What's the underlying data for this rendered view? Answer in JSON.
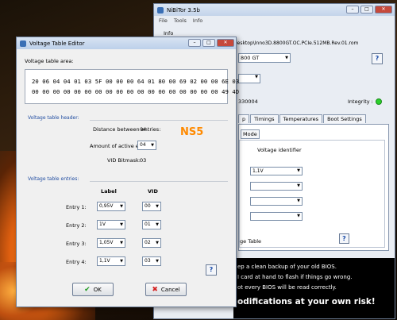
{
  "back_window": {
    "title": "NiBiTor 3.5b",
    "menu": [
      "File",
      "Tools",
      "Info"
    ],
    "info_label": "Info",
    "bios_path": "\\Desktop\\Inno3D.8800GT.OC.PCIe.512MB.Rev.01.rom",
    "card_select": "800 GT",
    "code_text": "330004",
    "integrity_label": "Integrity :",
    "integrity_color": "#2bd02b",
    "tabs": [
      "p",
      "Timings",
      "Temperatures",
      "Boot Settings"
    ],
    "mode_label": "Mode",
    "voltage_identifier_label": "Voltage identifier",
    "voltage_selects": [
      "1,1V",
      "",
      "",
      "",
      ""
    ],
    "voltage_table_label": "ge Table",
    "warnings": [
      "ep a clean backup of your old BIOS.",
      "I card at hand to flash if things go wrong.",
      "ot every BIOS will be read correctly."
    ],
    "warning_big": "odifications at your own risk!"
  },
  "editor": {
    "title": "Voltage Table Editor",
    "area_label": "Voltage table area:",
    "hex_lines": [
      "20 06 04 04 01 03 5F 00 00 00 64 01 80 00 69 02 00 00 6E 03",
      "00 00 00 00 00 00 00 00 00 00 00 00 00 00 00 00 00 00 49 4D"
    ],
    "header_section": "Voltage table header:",
    "distance_label": "Distance between entries:",
    "distance_value": "04",
    "active_label": "Amount of active entries:",
    "active_value": "04",
    "bitmask_label": "VID Bitmask:",
    "bitmask_value": "03",
    "annotation": "NS5",
    "entries_section": "Voltage table entries:",
    "col_label": "Label",
    "col_vid": "VID",
    "entries": [
      {
        "name": "Entry 1:",
        "label": "0,95V",
        "vid": "00"
      },
      {
        "name": "Entry 2:",
        "label": "1V",
        "vid": "01"
      },
      {
        "name": "Entry 3:",
        "label": "1,05V",
        "vid": "02"
      },
      {
        "name": "Entry 4:",
        "label": "1,1V",
        "vid": "03"
      }
    ],
    "help": "?",
    "ok_label": "OK",
    "cancel_label": "Cancel"
  }
}
